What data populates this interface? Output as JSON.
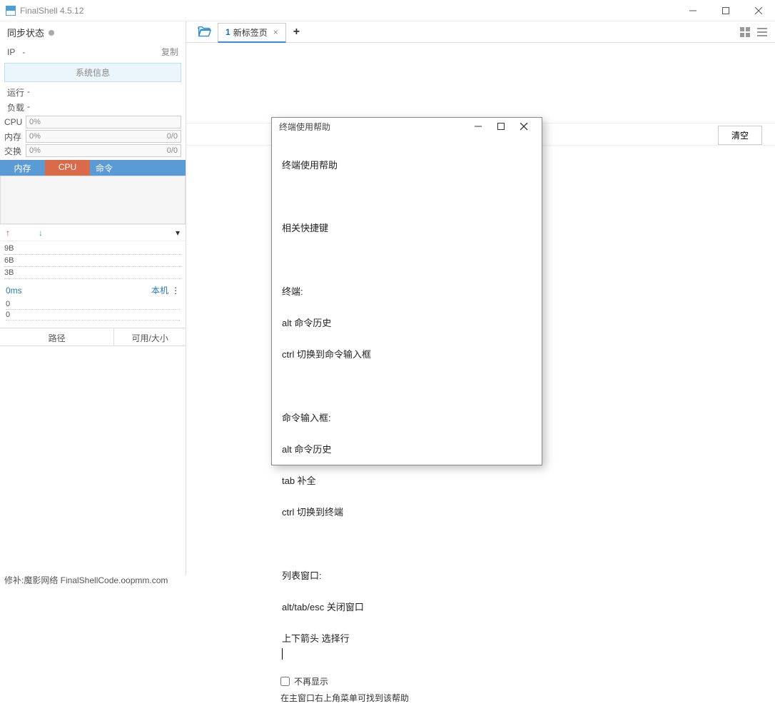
{
  "titlebar": {
    "title": "FinalShell 4.5.12"
  },
  "sidebar": {
    "sync_label": "同步状态",
    "ip_label": "IP",
    "ip_value": "-",
    "copy_label": "复制",
    "sysinfo_btn": "系统信息",
    "run_label": "运行",
    "run_value": "-",
    "load_label": "负载",
    "load_value": "-",
    "meters": {
      "cpu": {
        "label": "CPU",
        "value": "0%"
      },
      "mem": {
        "label": "内存",
        "value": "0%",
        "extra": "0/0"
      },
      "swap": {
        "label": "交换",
        "value": "0%",
        "extra": "0/0"
      }
    },
    "mini_tabs": {
      "mem": "内存",
      "cpu": "CPU",
      "cmd": "命令"
    },
    "net_graph": {
      "rows": [
        "9B",
        "6B",
        "3B"
      ]
    },
    "ping": {
      "ms": "0ms",
      "host": "本机",
      "rows": [
        "0",
        "0"
      ]
    },
    "path_header": {
      "path": "路径",
      "avail": "可用/大小"
    }
  },
  "tabbar": {
    "tab_num": "1",
    "tab_label": "新标签页"
  },
  "content": {
    "clear_btn": "清空"
  },
  "dialog": {
    "title": "终端使用帮助",
    "heading": "终端使用帮助",
    "sec_shortcut": "相关快捷键",
    "sec_terminal": "终端:",
    "t_alt": "alt 命令历史",
    "t_ctrl": "ctrl 切换到命令输入框",
    "sec_input": "命令输入框:",
    "i_alt": "alt 命令历史",
    "i_tab": "tab 补全",
    "i_ctrl": "ctrl 切换到终端",
    "sec_list": "列表窗口:",
    "l_esc": "alt/tab/esc 关闭窗口",
    "l_arrow": "上下箭头 选择行",
    "noshow": "不再显示",
    "footnote": "在主窗口右上角菜单可找到该帮助"
  },
  "statusbar": {
    "text": "修补:魔影网络 FinalShellCode.oopmm.com"
  }
}
